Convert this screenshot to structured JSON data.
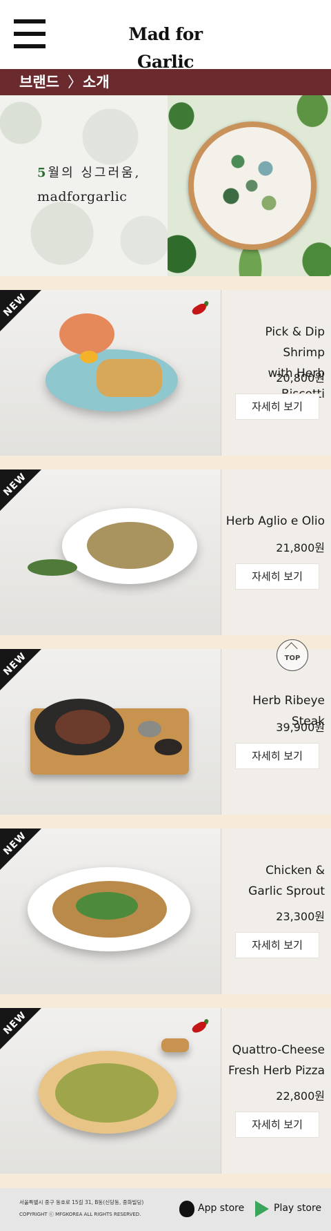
{
  "header": {
    "logo_text": "Mad for Garlic"
  },
  "breadcrumb": {
    "brand": "브랜드",
    "separator": "〉",
    "current": "소개"
  },
  "hero": {
    "line1_num": "5",
    "line1_rest": "월의 싱그러움,",
    "line2": "madforgarlic"
  },
  "menu_items": [
    {
      "badge": "NEW",
      "spicy": true,
      "name": "Pick & Dip Shrimp\nwith Herb Biscotti",
      "price": "20,800원",
      "button": "자세히 보기"
    },
    {
      "badge": "NEW",
      "spicy": false,
      "name": "Herb Aglio e Olio",
      "price": "21,800원",
      "button": "자세히 보기"
    },
    {
      "badge": "NEW",
      "spicy": false,
      "name": "Herb Ribeye Steak",
      "price": "39,900원",
      "button": "자세히 보기"
    },
    {
      "badge": "NEW",
      "spicy": false,
      "name": "Chicken &\nGarlic Sprout",
      "price": "23,300원",
      "button": "자세히 보기"
    },
    {
      "badge": "NEW",
      "spicy": true,
      "name": "Quattro-Cheese\nFresh Herb Pizza",
      "price": "22,800원",
      "button": "자세히 보기"
    }
  ],
  "top_button": {
    "label": "TOP"
  },
  "footer": {
    "address": "서울특별시 중구 동호로 15길 31, B동(신당동, 중화빌딩)",
    "copyright": "COPYRIGHT ⓒ MFGKOREA ALL RIGHTS RESERVED.",
    "app_store": "App store",
    "play_store": "Play store"
  },
  "colors": {
    "breadcrumb_bg": "#6b2a2d",
    "page_bg": "#f6ead9",
    "card_info_bg": "#f1ede8",
    "badge": "#161616"
  }
}
